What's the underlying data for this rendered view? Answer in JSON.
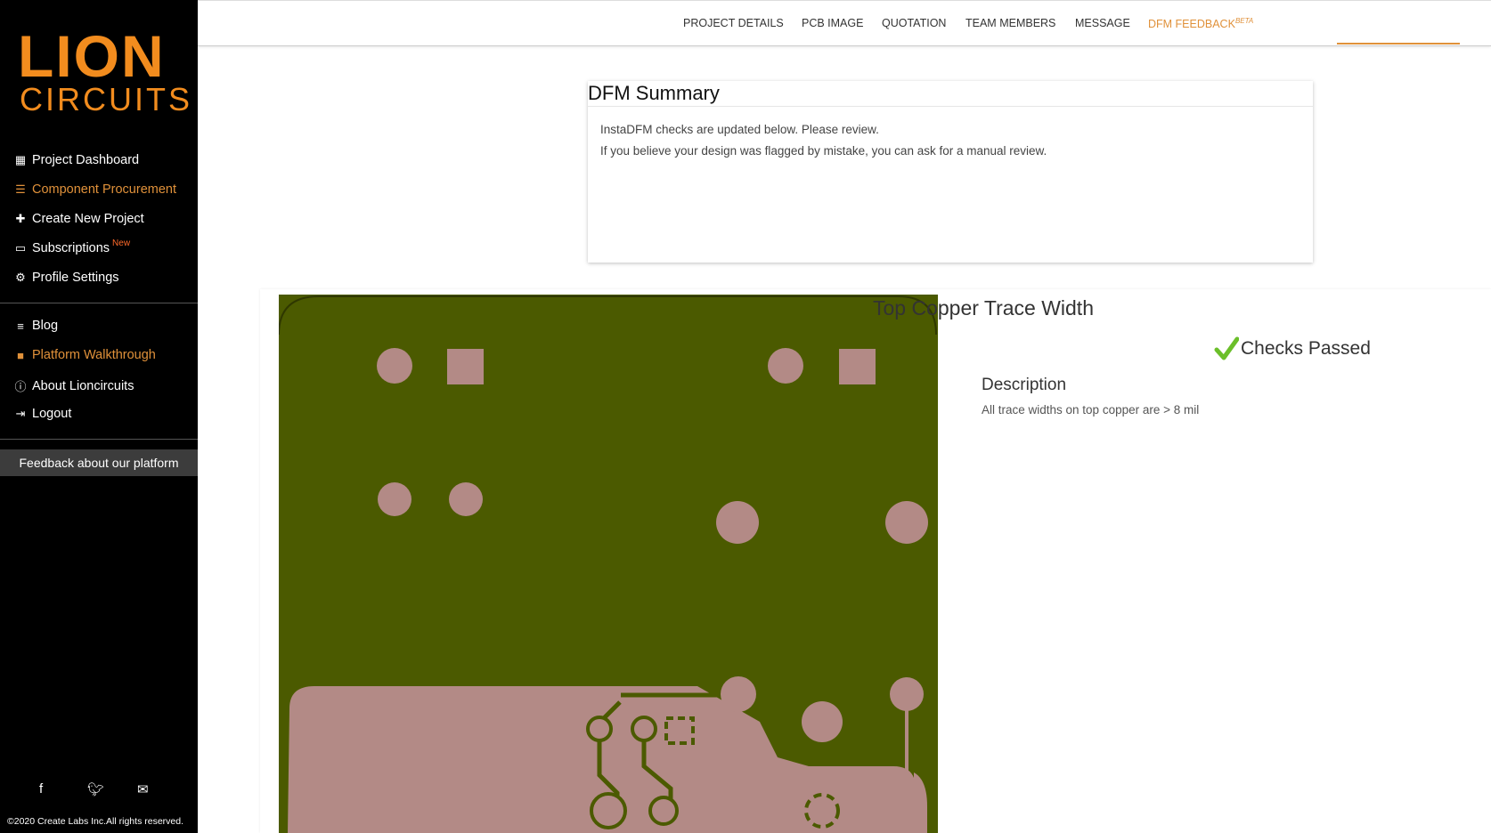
{
  "brand": {
    "logo_line1": "LION",
    "logo_line2": "CIRCUITS",
    "accent_color": "#f28c1e"
  },
  "sidebar": {
    "nav": [
      {
        "label": "Project Dashboard",
        "icon": "dashboard-icon"
      },
      {
        "label": "Component Procurement",
        "icon": "components-icon"
      },
      {
        "label": "Create New Project",
        "icon": "plus-icon"
      },
      {
        "label": "Subscriptions",
        "badge": "New",
        "icon": "monitor-icon"
      },
      {
        "label": "Profile Settings",
        "icon": "gear-icon"
      }
    ],
    "nav2": [
      {
        "label": "Blog",
        "icon": "list-icon"
      },
      {
        "label": "Platform Walkthrough",
        "icon": "video-icon"
      },
      {
        "label": "About Lioncircuits",
        "icon": "info-icon"
      },
      {
        "label": "Logout",
        "icon": "logout-icon"
      }
    ],
    "feedback": "Feedback about our platform",
    "social": [
      "facebook-icon",
      "twitter-icon",
      "email-icon"
    ],
    "copyright": "©2020 Create Labs Inc.All rights reserved."
  },
  "tabs": [
    {
      "label": "PROJECT DETAILS"
    },
    {
      "label": "PCB IMAGE"
    },
    {
      "label": "QUOTATION"
    },
    {
      "label": "TEAM MEMBERS"
    },
    {
      "label": "MESSAGE"
    },
    {
      "label": "DFM FEEDBACK",
      "sup": "BETA",
      "active": true
    }
  ],
  "summary": {
    "title": "DFM Summary",
    "line1": "InstaDFM checks are updated below. Please review.",
    "line2": "If you believe your design was flagged by mistake, you can ask for a manual review."
  },
  "check": {
    "title": "Top Copper Trace Width",
    "status": "Checks Passed",
    "description_heading": "Description",
    "description": "All trace widths on top copper are > 8 mil"
  },
  "colors": {
    "board": "#4b5a00",
    "copper": "#b38a86",
    "check_green": "#6bbf2a"
  }
}
